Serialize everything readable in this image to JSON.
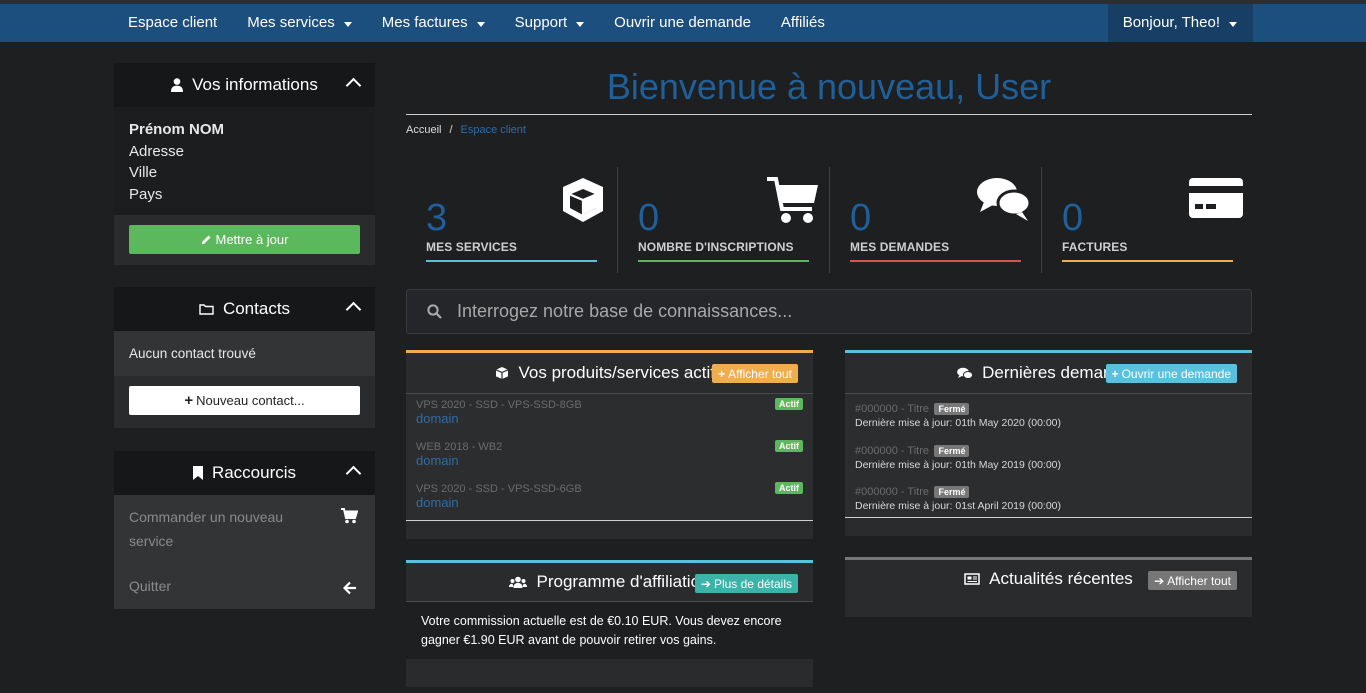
{
  "nav": {
    "items": [
      {
        "label": "Espace client",
        "caret": false
      },
      {
        "label": "Mes services",
        "caret": true
      },
      {
        "label": "Mes factures",
        "caret": true
      },
      {
        "label": "Support",
        "caret": true
      },
      {
        "label": "Ouvrir une demande",
        "caret": false
      },
      {
        "label": "Affiliés",
        "caret": false
      }
    ],
    "user": "Bonjour, Theo!"
  },
  "sidebar": {
    "info": {
      "title": "Vos informations",
      "name": "Prénom NOM",
      "address": "Adresse",
      "city": "Ville",
      "country": "Pays",
      "update_button": "Mettre à jour"
    },
    "contacts": {
      "title": "Contacts",
      "empty": "Aucun contact trouvé",
      "new_button": "Nouveau contact..."
    },
    "shortcuts": {
      "title": "Raccourcis",
      "items": [
        {
          "label": "Commander un nouveau service",
          "icon": "cart-icon"
        },
        {
          "label": "Quitter",
          "icon": "arrow-left-icon"
        }
      ]
    }
  },
  "main": {
    "title": "Bienvenue à nouveau, User",
    "breadcrumb": {
      "home": "Accueil",
      "separator": "/",
      "current": "Espace client"
    },
    "stats": [
      {
        "value": "3",
        "label": "MES SERVICES",
        "color": "#5bc0de",
        "icon": "cube-icon"
      },
      {
        "value": "0",
        "label": "NOMBRE D'INSCRIPTIONS",
        "color": "#5cb85c",
        "icon": "cart-icon"
      },
      {
        "value": "0",
        "label": "MES DEMANDES",
        "color": "#d9534f",
        "icon": "comments-icon"
      },
      {
        "value": "0",
        "label": "FACTURES",
        "color": "#f0ad4e",
        "icon": "credit-card-icon"
      }
    ],
    "search_placeholder": "Interrogez notre base de connaissances...",
    "products": {
      "title": "Vos produits/services actifs",
      "button": "Afficher tout",
      "accent": "#f0ad4e",
      "items": [
        {
          "name": "VPS 2020 - SSD - VPS-SSD-8GB",
          "domain": "domain",
          "status": "Actif"
        },
        {
          "name": "WEB 2018 - WB2",
          "domain": "domain",
          "status": "Actif"
        },
        {
          "name": "VPS 2020 - SSD - VPS-SSD-6GB",
          "domain": "domain",
          "status": "Actif"
        }
      ]
    },
    "tickets": {
      "title": "Dernières demandes",
      "button": "Ouvrir une demande",
      "accent": "#5bc0de",
      "items": [
        {
          "ref": "#000000 - Titre",
          "status": "Fermé",
          "updated": "Dernière mise à jour: 01th May 2020 (00:00)"
        },
        {
          "ref": "#000000 - Titre",
          "status": "Fermé",
          "updated": "Dernière mise à jour: 01th May 2019 (00:00)"
        },
        {
          "ref": "#000000 - Titre",
          "status": "Fermé",
          "updated": "Dernière mise à jour: 01st April 2019 (00:00)"
        }
      ]
    },
    "affiliate": {
      "title": "Programme d'affiliation",
      "button": "Plus de détails",
      "accent": "#5bc0de",
      "text": "Votre commission actuelle est de €0.10 EUR. Vous devez encore gagner €1.90 EUR avant de pouvoir retirer vos gains."
    },
    "news": {
      "title": "Actualités récentes",
      "button": "Afficher tout",
      "accent": "#777777"
    }
  }
}
